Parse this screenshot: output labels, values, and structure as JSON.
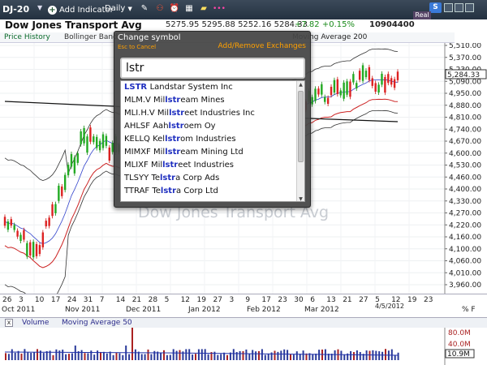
{
  "toolbar": {
    "symbol": "DJ-20",
    "add_indicator": "Add Indicator",
    "period": "Daily",
    "s_button": "S",
    "realtime": "Real"
  },
  "header": {
    "name": "Dow Jones Transport Avg",
    "ohlc": "5275.95  5295.88  5252.16  5284.33",
    "change": "+7.82  +0.15%",
    "volume": "10904400"
  },
  "indicators": {
    "price_history": "Price History",
    "bollinger": "Bollinger Band",
    "ma_text": "Moving Average 200"
  },
  "price_axis": {
    "labels": [
      "5,510.00",
      "5,370.00",
      "5,230.00",
      "5,090.00",
      "4,950.00",
      "4,880.00",
      "4,810.00",
      "4,740.00",
      "4,670.00",
      "4,600.00",
      "4,530.00",
      "4,460.00",
      "4,400.00",
      "4,330.00",
      "4,270.00",
      "4,220.00",
      "4,160.00",
      "4,100.00",
      "4,060.00",
      "4,010.00",
      "3,960.00"
    ],
    "current": "5,284.33"
  },
  "watermark": "Dow Jones Transport Avg",
  "date_axis": {
    "days": [
      "26",
      "3",
      "10",
      "17",
      "24",
      "31",
      "7",
      "14",
      "21",
      "28",
      "5",
      "12",
      "19",
      "27",
      "3",
      "9",
      "17",
      "23",
      "30",
      "6",
      "13",
      "21",
      "27",
      "5",
      "12",
      "19",
      "23"
    ],
    "months": [
      "Oct 2011",
      "Nov 2011",
      "Dec 2011",
      "Jan 2012",
      "Feb 2012",
      "Mar 2012"
    ],
    "cursor_date": "4/5/2012",
    "controls": "% F"
  },
  "volume": {
    "label": "Volume",
    "ma_label": "Moving Average 50",
    "axis": [
      "80.0M",
      "40.0M",
      "0.0M"
    ],
    "current": "10.9M"
  },
  "dialog": {
    "title": "Change symbol",
    "esc_hint": "Esc to Cancel",
    "add_remove": "Add/Remove Exchanges",
    "input_value": "lstr",
    "results": [
      {
        "ticker": "LSTR",
        "pre": "",
        "match": "LSTR",
        "post": " Landstar System Inc"
      },
      {
        "ticker": "MLM.V",
        "pre": "Mil",
        "match": "lstr",
        "post": "eam Mines"
      },
      {
        "ticker": "MLI.H.V",
        "pre": "Mil",
        "match": "lstr",
        "post": "eet Industries Inc"
      },
      {
        "ticker": "AHLSF",
        "pre": "Aah",
        "match": "lstr",
        "post": "oem Oy"
      },
      {
        "ticker": "KELLQ",
        "pre": "Kel",
        "match": "lstr",
        "post": "om Industries"
      },
      {
        "ticker": "MIMXF",
        "pre": "Mil",
        "match": "lstr",
        "post": "eam Mining Ltd"
      },
      {
        "ticker": "MLIXF",
        "pre": "Mil",
        "match": "lstr",
        "post": "eet Industries"
      },
      {
        "ticker": "TLSYY",
        "pre": "Te",
        "match": "lstr",
        "post": "a Corp Ads"
      },
      {
        "ticker": "TTRAF",
        "pre": "Te",
        "match": "lstr",
        "post": "a Corp Ltd"
      }
    ]
  }
}
